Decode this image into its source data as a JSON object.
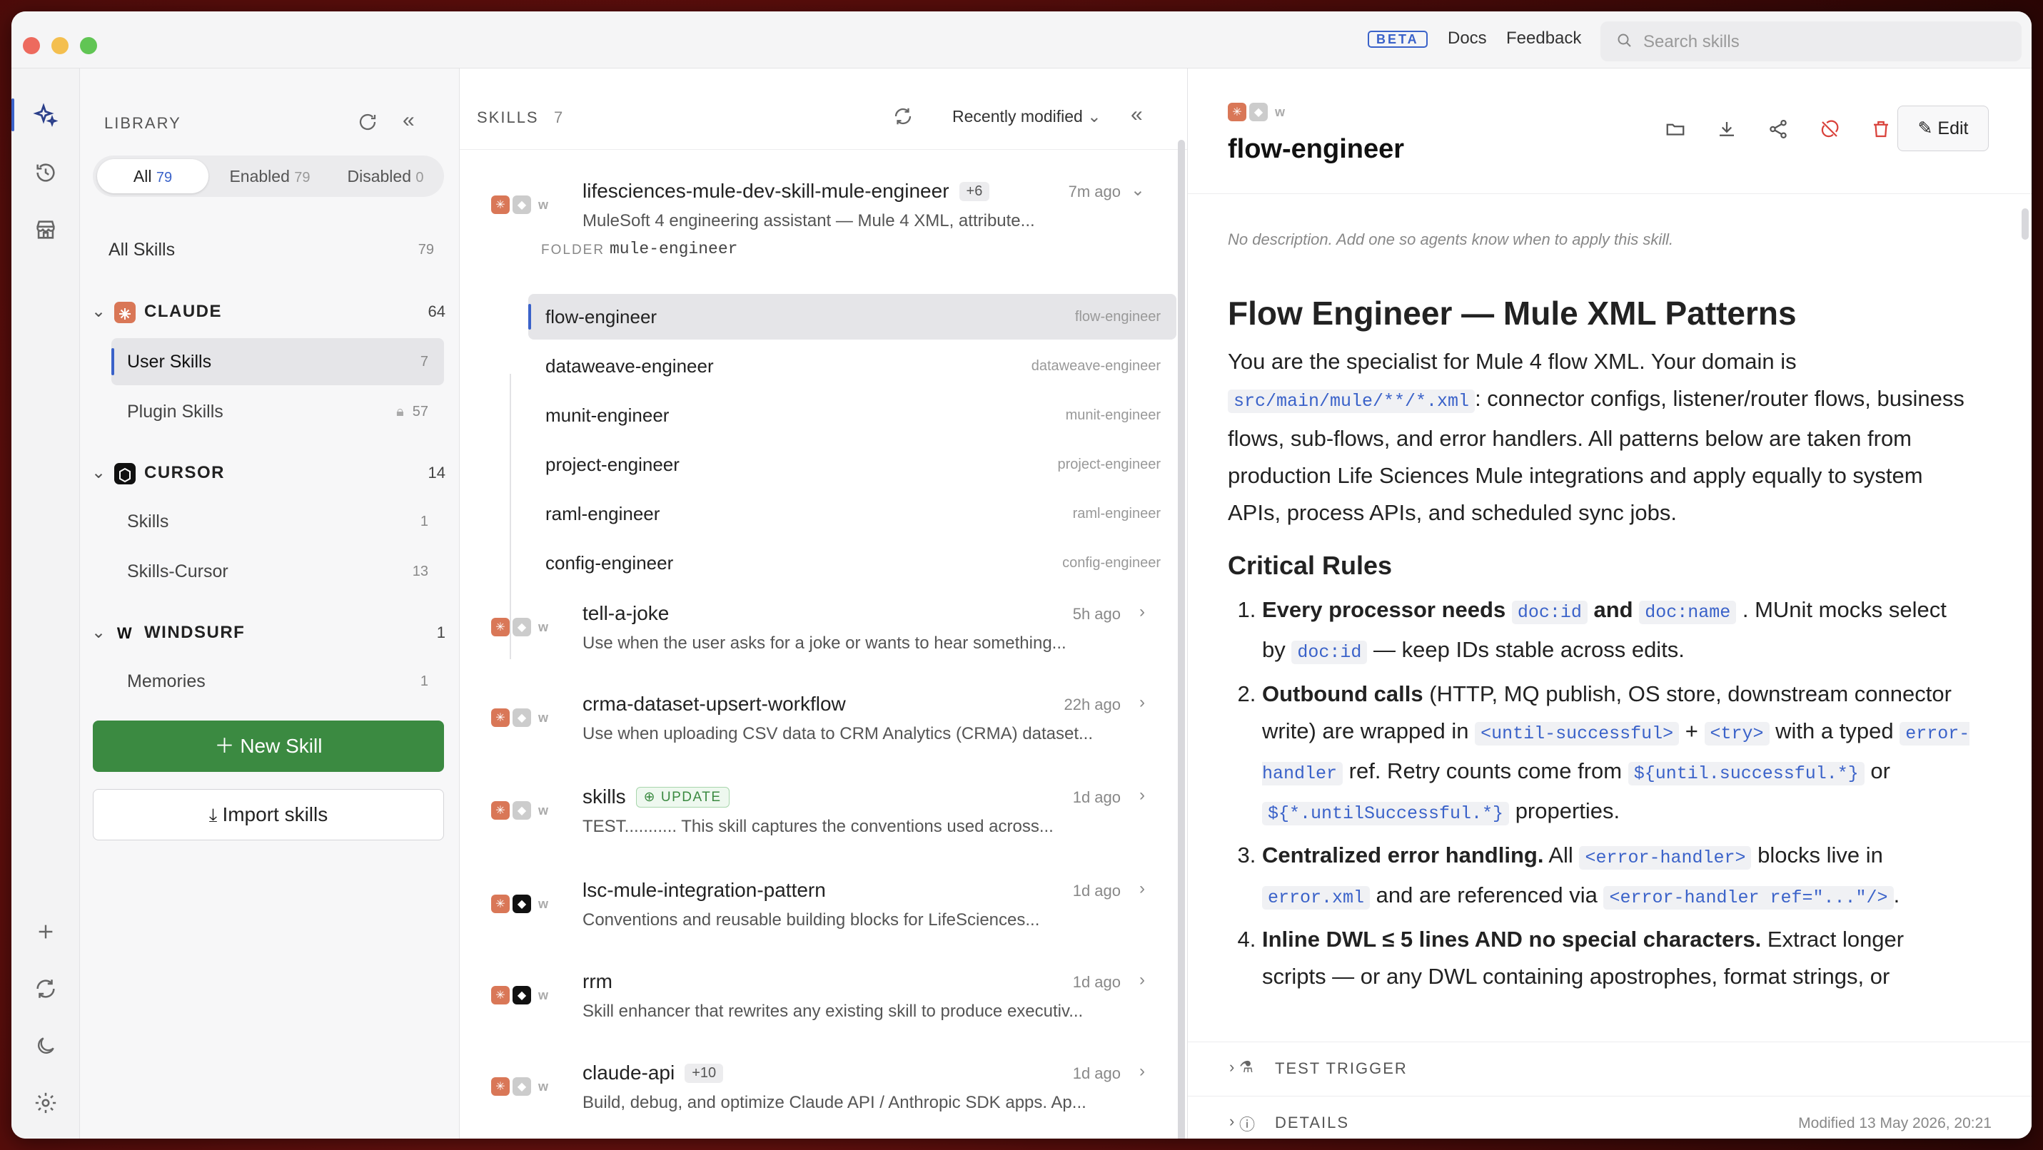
{
  "titlebar": {
    "beta": "BETA",
    "docs": "Docs",
    "feedback": "Feedback",
    "search_placeholder": "Search skills"
  },
  "library": {
    "title": "LIBRARY",
    "filters": [
      {
        "label": "All",
        "count": "79"
      },
      {
        "label": "Enabled",
        "count": "79"
      },
      {
        "label": "Disabled",
        "count": "0"
      }
    ],
    "all_skills": {
      "label": "All Skills",
      "count": "79"
    },
    "groups": [
      {
        "name": "CLAUDE",
        "count": "64",
        "items": [
          {
            "label": "User Skills",
            "count": "7"
          },
          {
            "label": "Plugin Skills",
            "count": "57"
          }
        ]
      },
      {
        "name": "CURSOR",
        "count": "14",
        "items": [
          {
            "label": "Skills",
            "count": "1"
          },
          {
            "label": "Skills-Cursor",
            "count": "13"
          }
        ]
      },
      {
        "name": "WINDSURF",
        "count": "1",
        "items": [
          {
            "label": "Memories",
            "count": "1"
          }
        ]
      }
    ],
    "new_skill": "New Skill",
    "import_skills": "Import skills"
  },
  "skills": {
    "header": "SKILLS",
    "count": "7",
    "sort": "Recently modified",
    "folder_label": "FOLDER",
    "folder_name": "mule-engineer",
    "items": [
      {
        "title": "lifesciences-mule-dev-skill-mule-engineer",
        "chip": "+6",
        "time": "7m ago",
        "desc": "MuleSoft 4 engineering assistant — Mule 4 XML, attribute..."
      },
      {
        "title": "tell-a-joke",
        "time": "5h ago",
        "desc": "Use when the user asks for a joke or wants to hear something..."
      },
      {
        "title": "crma-dataset-upsert-workflow",
        "time": "22h ago",
        "desc": "Use when uploading CSV data to CRM Analytics (CRMA) dataset..."
      },
      {
        "title": "skills",
        "badge": "UPDATE",
        "time": "1d ago",
        "desc": "TEST........... This skill captures the conventions used across..."
      },
      {
        "title": "lsc-mule-integration-pattern",
        "time": "1d ago",
        "desc": "Conventions and reusable building blocks for LifeSciences..."
      },
      {
        "title": "rrm",
        "time": "1d ago",
        "desc": "Skill enhancer that rewrites any existing skill to produce executiv..."
      },
      {
        "title": "claude-api",
        "chip": "+10",
        "time": "1d ago",
        "desc": "Build, debug, and optimize Claude API / Anthropic SDK apps. Ap..."
      }
    ],
    "children": [
      {
        "name": "flow-engineer",
        "slug": "flow-engineer"
      },
      {
        "name": "dataweave-engineer",
        "slug": "dataweave-engineer"
      },
      {
        "name": "munit-engineer",
        "slug": "munit-engineer"
      },
      {
        "name": "project-engineer",
        "slug": "project-engineer"
      },
      {
        "name": "raml-engineer",
        "slug": "raml-engineer"
      },
      {
        "name": "config-engineer",
        "slug": "config-engineer"
      }
    ]
  },
  "detail": {
    "title": "flow-engineer",
    "edit": "Edit",
    "no_desc": "No description. Add one so agents know when to apply this skill.",
    "h1": "Flow Engineer — Mule XML Patterns",
    "intro_a": "You are the specialist for Mule 4 flow XML. Your domain is",
    "intro_code": "src/main/mule/**/*.xml",
    "intro_b": ": connector configs, listener/router flows, business flows, sub-flows, and error handlers. All patterns below are taken from production Life Sciences Mule integrations and apply equally to system APIs, process APIs, and scheduled sync jobs.",
    "h2": "Critical Rules",
    "r1_b": "Every processor needs",
    "r1_c1": "doc:id",
    "r1_and": "and",
    "r1_c2": "doc:name",
    "r1_t": ". MUnit mocks select by",
    "r1_c3": "doc:id",
    "r1_t2": "— keep IDs stable across edits.",
    "r2_b": "Outbound calls",
    "r2_t": "(HTTP, MQ publish, OS store, downstream connector write) are wrapped in",
    "r2_c1": "<until-successful>",
    "r2_plus": "+",
    "r2_c2": "<try>",
    "r2_t2": "with a typed",
    "r2_c3": "error-handler",
    "r2_t3": "ref. Retry counts come from",
    "r2_c4": "${until.successful.*}",
    "r2_or": "or",
    "r2_c5": "${*.untilSuccessful.*}",
    "r2_t4": "properties.",
    "r3_b": "Centralized error handling.",
    "r3_t": "All",
    "r3_c1": "<error-handler>",
    "r3_t2": "blocks live in",
    "r3_c2": "error.xml",
    "r3_t3": "and are referenced via",
    "r3_c3": "<error-handler ref=\"...\"/>",
    "r3_t4": ".",
    "r4_b": "Inline DWL ≤ 5 lines AND no special characters.",
    "r4_t": "Extract longer scripts — or any DWL containing apostrophes, format strings, or",
    "test_trigger": "TEST TRIGGER",
    "details": "DETAILS",
    "modified": "Modified 13 May 2026, 20:21"
  }
}
